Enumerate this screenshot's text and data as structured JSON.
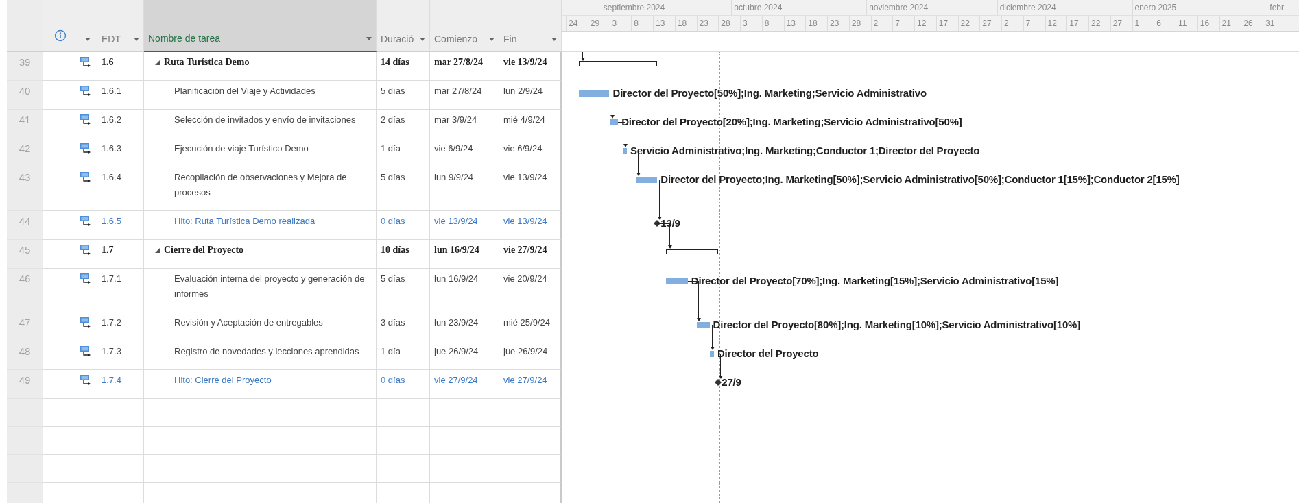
{
  "table": {
    "columns": [
      {
        "label": "EDT",
        "selected": false
      },
      {
        "label": "Nombre de tarea",
        "selected": true
      },
      {
        "label": "Duració",
        "selected": false
      },
      {
        "label": "Comienzo",
        "selected": false
      },
      {
        "label": "Fin",
        "selected": false
      }
    ],
    "rows": [
      {
        "row_number": "39",
        "wbs": "1.6",
        "name": "Ruta Turística Demo",
        "duration": "14 días",
        "start": "mar 27/8/24",
        "finish": "vie 13/9/24",
        "kind": "summary",
        "expanded": true,
        "children": [
          {
            "row_number": "40",
            "wbs": "1.6.1",
            "name": "Planificación del Viaje y Actividades",
            "duration": "5 días",
            "start": "mar 27/8/24",
            "finish": "lun 2/9/24",
            "kind": "task",
            "bar_label": "Director del Proyecto[50%];Ing. Marketing;Servicio Administrativo"
          },
          {
            "row_number": "41",
            "wbs": "1.6.2",
            "name": "Selección de invitados y envío de invitaciones",
            "duration": "2 días",
            "start": "mar 3/9/24",
            "finish": "mié 4/9/24",
            "kind": "task",
            "bar_label": "Director del Proyecto[20%];Ing. Marketing;Servicio Administrativo[50%]"
          },
          {
            "row_number": "42",
            "wbs": "1.6.3",
            "name": "Ejecución de viaje Turístico Demo",
            "duration": "1 día",
            "start": "vie 6/9/24",
            "finish": "vie 6/9/24",
            "kind": "task",
            "bar_label": "Servicio Administrativo;Ing. Marketing;Conductor 1;Director del Proyecto"
          },
          {
            "row_number": "43",
            "wbs": "1.6.4",
            "name": "Recopilación de observaciones y Mejora de procesos",
            "duration": "5 días",
            "start": "lun 9/9/24",
            "finish": "vie 13/9/24",
            "kind": "task",
            "bar_label": "Director del Proyecto;Ing. Marketing[50%];Servicio Administrativo[50%];Conductor 1[15%];Conductor 2[15%]"
          },
          {
            "row_number": "44",
            "wbs": "1.6.5",
            "name": "Hito: Ruta Turística Demo realizada",
            "duration": "0 días",
            "start": "vie 13/9/24",
            "finish": "vie 13/9/24",
            "kind": "milestone",
            "bar_label": "13/9"
          }
        ]
      },
      {
        "row_number": "45",
        "wbs": "1.7",
        "name": "Cierre del Proyecto",
        "duration": "10 días",
        "start": "lun 16/9/24",
        "finish": "vie 27/9/24",
        "kind": "summary",
        "expanded": true,
        "children": [
          {
            "row_number": "46",
            "wbs": "1.7.1",
            "name": "Evaluación interna del proyecto y generación de informes",
            "duration": "5 días",
            "start": "lun 16/9/24",
            "finish": "vie 20/9/24",
            "kind": "task",
            "bar_label": "Director del Proyecto[70%];Ing. Marketing[15%];Servicio Administrativo[15%]"
          },
          {
            "row_number": "47",
            "wbs": "1.7.2",
            "name": "Revisión y Aceptación de entregables",
            "duration": "3 días",
            "start": "lun 23/9/24",
            "finish": "mié 25/9/24",
            "kind": "task",
            "bar_label": "Director del Proyecto[80%];Ing. Marketing[10%];Servicio Administrativo[10%]"
          },
          {
            "row_number": "48",
            "wbs": "1.7.3",
            "name": "Registro de novedades y lecciones aprendidas",
            "duration": "1 día",
            "start": "jue 26/9/24",
            "finish": "jue 26/9/24",
            "kind": "task",
            "bar_label": "Director del Proyecto"
          },
          {
            "row_number": "49",
            "wbs": "1.7.4",
            "name": "Hito: Cierre del Proyecto",
            "duration": "0 días",
            "start": "vie 27/9/24",
            "finish": "vie 27/9/24",
            "kind": "milestone",
            "bar_label": "27/9"
          }
        ]
      }
    ]
  },
  "timescale": {
    "months": [
      "septiembre 2024",
      "octubre 2024",
      "noviembre 2024",
      "diciembre 2024",
      "enero 2025",
      "febr"
    ],
    "days": [
      "24",
      "29",
      "3",
      "8",
      "13",
      "18",
      "23",
      "28",
      "3",
      "8",
      "13",
      "18",
      "23",
      "28",
      "2",
      "7",
      "12",
      "17",
      "22",
      "27",
      "2",
      "7",
      "12",
      "17",
      "22",
      "27",
      "1",
      "6",
      "11",
      "16",
      "21",
      "26",
      "31"
    ]
  }
}
